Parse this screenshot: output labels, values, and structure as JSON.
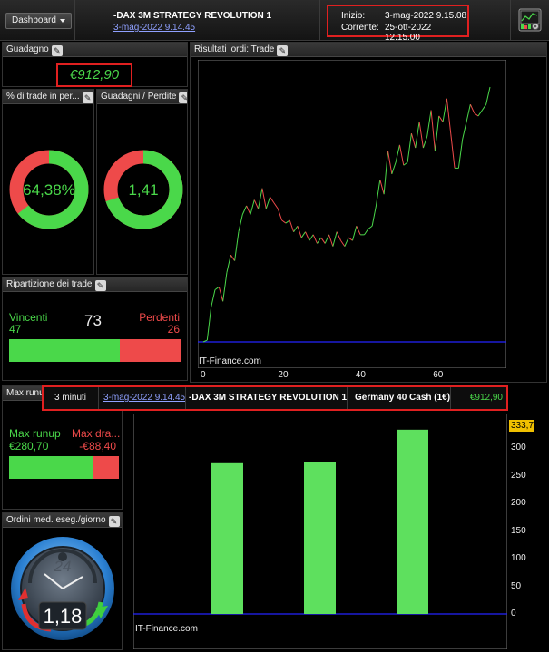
{
  "header": {
    "dashboard_label": "Dashboard",
    "strategy_title": "-DAX 3M  STRATEGY REVOLUTION 1",
    "strategy_date": "3-mag-2022 9.14.45",
    "start_label": "Inizio:",
    "start_value": "3-mag-2022 9.15.08",
    "current_label": "Corrente:",
    "current_value": "25-ott-2022 12.15.00",
    "settings_icon": "strategy-settings-icon"
  },
  "panels": {
    "gain": {
      "title": "Guadagno",
      "value": "€912,90"
    },
    "pct_trades": {
      "title": "% di trade in per...",
      "value": "64,38%",
      "fraction": 0.6438
    },
    "gain_loss": {
      "title": "Guadagni / Perdite",
      "value": "1,41",
      "fraction": 0.7
    },
    "breakdown": {
      "title": "Ripartizione dei trade",
      "winners_label": "Vincenti",
      "winners_value": "47",
      "total": "73",
      "losers_label": "Perdenti",
      "losers_value": "26",
      "win_fraction": 0.644
    },
    "runup": {
      "title": "Max runup",
      "runup_label": "Max runup",
      "runup_value": "€280,70",
      "drawdown_label": "Max dra...",
      "drawdown_value": "-€88,40",
      "runup_fraction": 0.76
    },
    "orders": {
      "title": "Ordini med. eseg./giorno",
      "clock_value": "24",
      "value": "1,18"
    },
    "results": {
      "title": "Risultati lordi: Trade",
      "watermark": "IT-Finance.com"
    }
  },
  "midbar": {
    "timeframe": "3 minuti",
    "date": "3-mag-2022 9.14.45",
    "strategy": "-DAX 3M  STRATEGY REVOLUTION 1",
    "instrument": "Germany 40 Cash (1€)",
    "gain": "€912,90"
  },
  "colors": {
    "green": "#4ad84a",
    "red": "#ee4a4a",
    "highlight": "#e02020",
    "baseline": "#2424ff",
    "badge": "#f0c000"
  },
  "chart_data": [
    {
      "type": "line",
      "title": "Risultati lordi: Trade",
      "x_ticks": [
        "0",
        "20",
        "40",
        "60"
      ],
      "xlim": [
        0,
        74
      ],
      "series": [
        {
          "values": [
            0,
            3,
            60,
            90,
            95,
            70,
            120,
            150,
            140,
            190,
            220,
            235,
            220,
            245,
            230,
            265,
            230,
            250,
            240,
            230,
            210,
            205,
            210,
            190,
            200,
            180,
            190,
            175,
            185,
            170,
            180,
            170,
            185,
            165,
            190,
            175,
            165,
            180,
            175,
            200,
            185,
            185,
            195,
            200,
            235,
            280,
            255,
            330,
            290,
            310,
            340,
            305,
            310,
            360,
            335,
            380,
            335,
            355,
            400,
            330,
            390,
            380,
            420,
            360,
            300,
            300,
            350,
            380,
            410,
            395,
            390,
            400,
            410,
            440
          ],
          "up_color": "#4ad84a",
          "down_color": "#ee4a4a"
        }
      ]
    },
    {
      "type": "bar",
      "categories": [
        "",
        "",
        ""
      ],
      "values": [
        273,
        275,
        333.7
      ],
      "ylim": [
        0,
        340
      ],
      "y_ticks": [
        "0",
        "50",
        "100",
        "150",
        "200",
        "250",
        "300"
      ],
      "last_value_label": "333,7",
      "watermark": "IT-Finance.com"
    }
  ]
}
